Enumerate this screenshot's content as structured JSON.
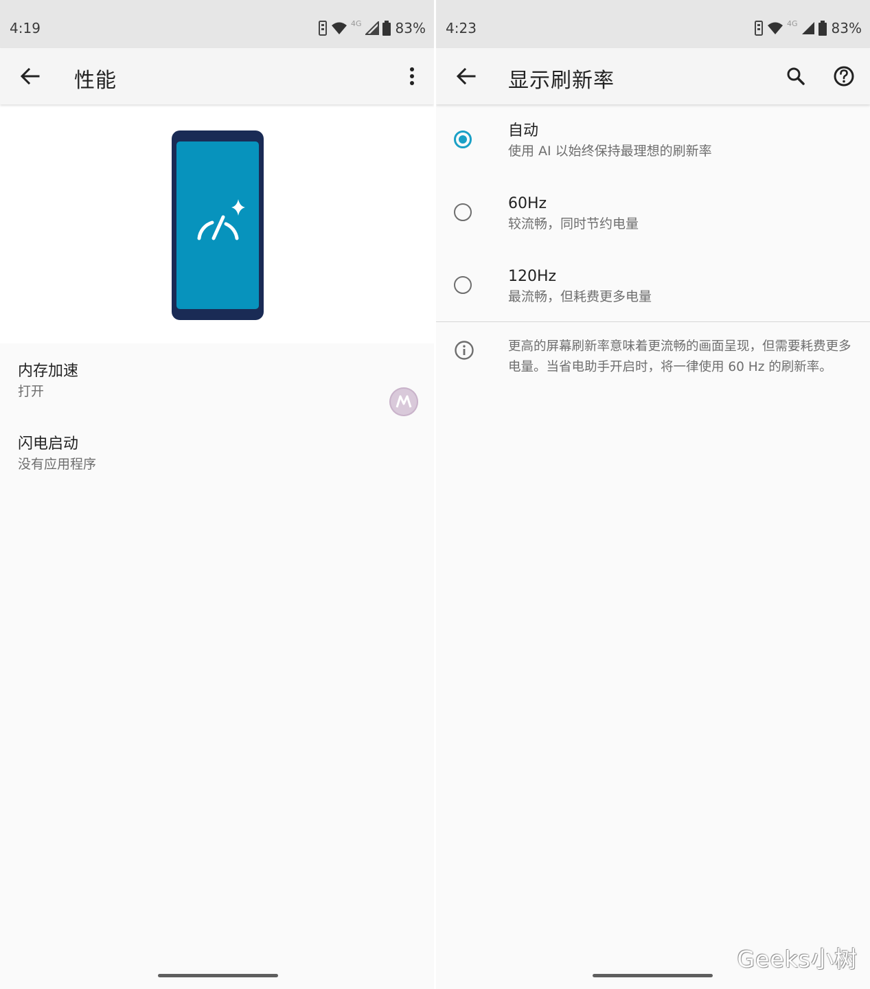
{
  "left": {
    "status": {
      "time": "4:19",
      "battery": "83%",
      "network": "4G"
    },
    "toolbar": {
      "title": "性能",
      "back_icon": "arrow-back-icon",
      "more_icon": "more-vert-icon"
    },
    "hero": {
      "icon": "performance-gauge-sparkle-icon",
      "screen_color": "#0793bd",
      "frame_color": "#1a2b55"
    },
    "prefs": [
      {
        "title": "内存加速",
        "summary": "打开"
      },
      {
        "title": "闪电启动",
        "summary": "没有应用程序"
      }
    ]
  },
  "right": {
    "status": {
      "time": "4:23",
      "battery": "83%",
      "network": "4G"
    },
    "toolbar": {
      "title": "显示刷新率",
      "back_icon": "arrow-back-icon",
      "search_icon": "search-icon",
      "help_icon": "help-icon"
    },
    "options": [
      {
        "title": "自动",
        "summary": "使用 AI 以始终保持最理想的刷新率",
        "checked": true
      },
      {
        "title": "60Hz",
        "summary": "较流畅，同时节约电量",
        "checked": false
      },
      {
        "title": "120Hz",
        "summary": "最流畅，但耗费更多电量",
        "checked": false
      }
    ],
    "info": "更高的屏幕刷新率意味着更流畅的画面呈现，但需要耗费更多电量。当省电助手开启时，将一律使用 60 Hz 的刷新率。"
  },
  "accent_color": "#1aa0c6",
  "watermark": "Geeks小树"
}
